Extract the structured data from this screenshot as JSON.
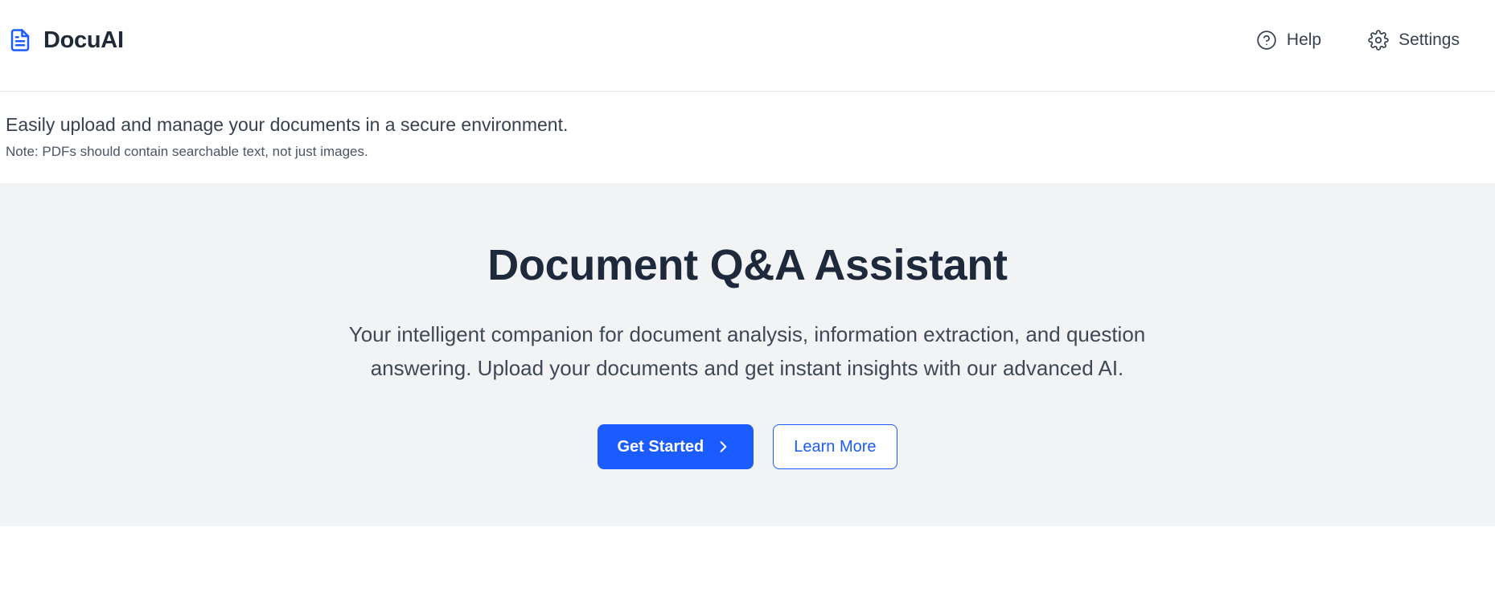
{
  "header": {
    "brand_name": "DocuAI",
    "brand_icon": "document-icon",
    "nav": [
      {
        "label": "Help",
        "icon": "help-circle-icon"
      },
      {
        "label": "Settings",
        "icon": "gear-icon"
      }
    ]
  },
  "intro": {
    "description": "Easily upload and manage your documents in a secure environment.",
    "note": "Note: PDFs should contain searchable text, not just images."
  },
  "hero": {
    "title": "Document Q&A Assistant",
    "description": "Your intelligent companion for document analysis, information extraction, and question answering. Upload your documents and get instant insights with our advanced AI.",
    "primary_button": {
      "label": "Get Started",
      "icon": "chevron-right-icon"
    },
    "secondary_button": {
      "label": "Learn More"
    }
  },
  "colors": {
    "accent": "#1a5cff",
    "hero_background": "#f2f3f5",
    "heading": "#1e293b"
  }
}
